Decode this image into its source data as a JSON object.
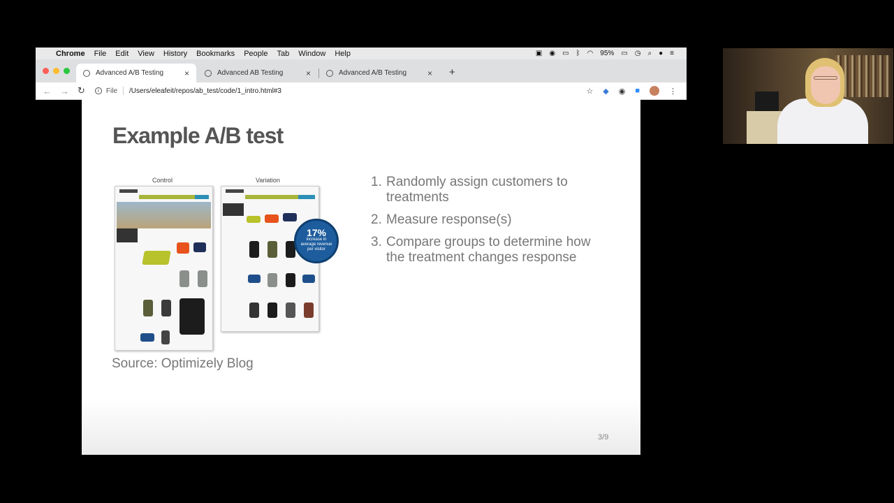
{
  "menubar": {
    "app": "Chrome",
    "items": [
      "File",
      "Edit",
      "View",
      "History",
      "Bookmarks",
      "People",
      "Tab",
      "Window",
      "Help"
    ],
    "battery": "95%"
  },
  "tabs": [
    {
      "label": "Advanced A/B Testing",
      "active": true
    },
    {
      "label": "Advanced AB Testing",
      "active": false
    },
    {
      "label": "Advanced A/B Testing",
      "active": false
    }
  ],
  "address": {
    "scheme": "File",
    "url": "/Users/eleafeit/repos/ab_test/code/1_intro.html#3"
  },
  "slide": {
    "title": "Example A/B test",
    "control_label": "Control",
    "variation_label": "Variation",
    "badge_pct": "17%",
    "badge_text": "increase in average revenue per visitor",
    "source": "Source: Optimizely Blog",
    "steps": [
      {
        "num": "1.",
        "text": "Randomly assign customers to treatments"
      },
      {
        "num": "2.",
        "text": "Measure response(s)"
      },
      {
        "num": "3.",
        "text": "Compare groups to determine how the treatment changes response"
      }
    ],
    "page": "3/9"
  },
  "colors": {
    "sock_green": "#b8c22a",
    "sock_orange": "#e8531d",
    "sock_navy": "#1f2f5a",
    "sock_black": "#1c1c1c",
    "sock_grey": "#8b8f8b",
    "badge": "#1d5d9e"
  }
}
